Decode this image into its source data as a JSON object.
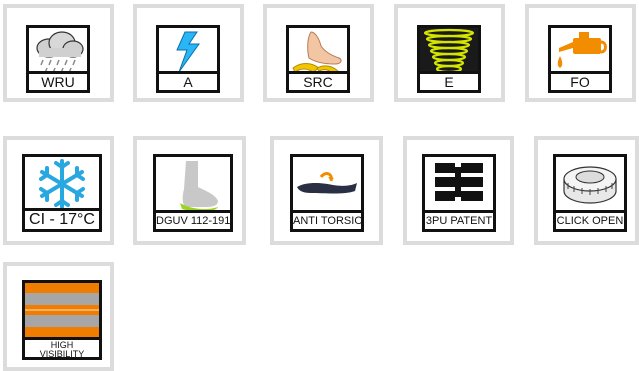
{
  "icons": [
    {
      "label": "WRU",
      "icon": "rain-cloud-icon"
    },
    {
      "label": "A",
      "icon": "lightning-bolt-icon"
    },
    {
      "label": "SRC",
      "icon": "foot-on-banana-peel-icon"
    },
    {
      "label": "E",
      "icon": "spring-coil-icon"
    },
    {
      "label": "FO",
      "icon": "oil-can-icon"
    },
    {
      "label": "CI - 17°C",
      "icon": "snowflake-icon"
    },
    {
      "label": "DGUV 112-191",
      "icon": "orthopedic-insole-foot-icon"
    },
    {
      "label": "ANTI TORSION",
      "icon": "twisted-sole-icon"
    },
    {
      "label": "3PU PATENT",
      "icon": "layered-sole-icon"
    },
    {
      "label": "CLICK OPEN",
      "icon": "dial-closure-icon"
    },
    {
      "label": "HIGH VISIBILITY",
      "icon": "reflective-stripes-icon"
    }
  ],
  "colors": {
    "tile_border": "#dcdcdc",
    "icon_border": "#111111",
    "lightning_blue": "#29b6f6",
    "snowflake_blue": "#29a8e0",
    "banana_yellow": "#f2c500",
    "spring_yellow": "#d4e600",
    "oil_orange": "#f28c00",
    "insole_green": "#9bd321",
    "hi_vis_orange": "#f07d00",
    "reflective_grey": "#a6a6a6"
  }
}
